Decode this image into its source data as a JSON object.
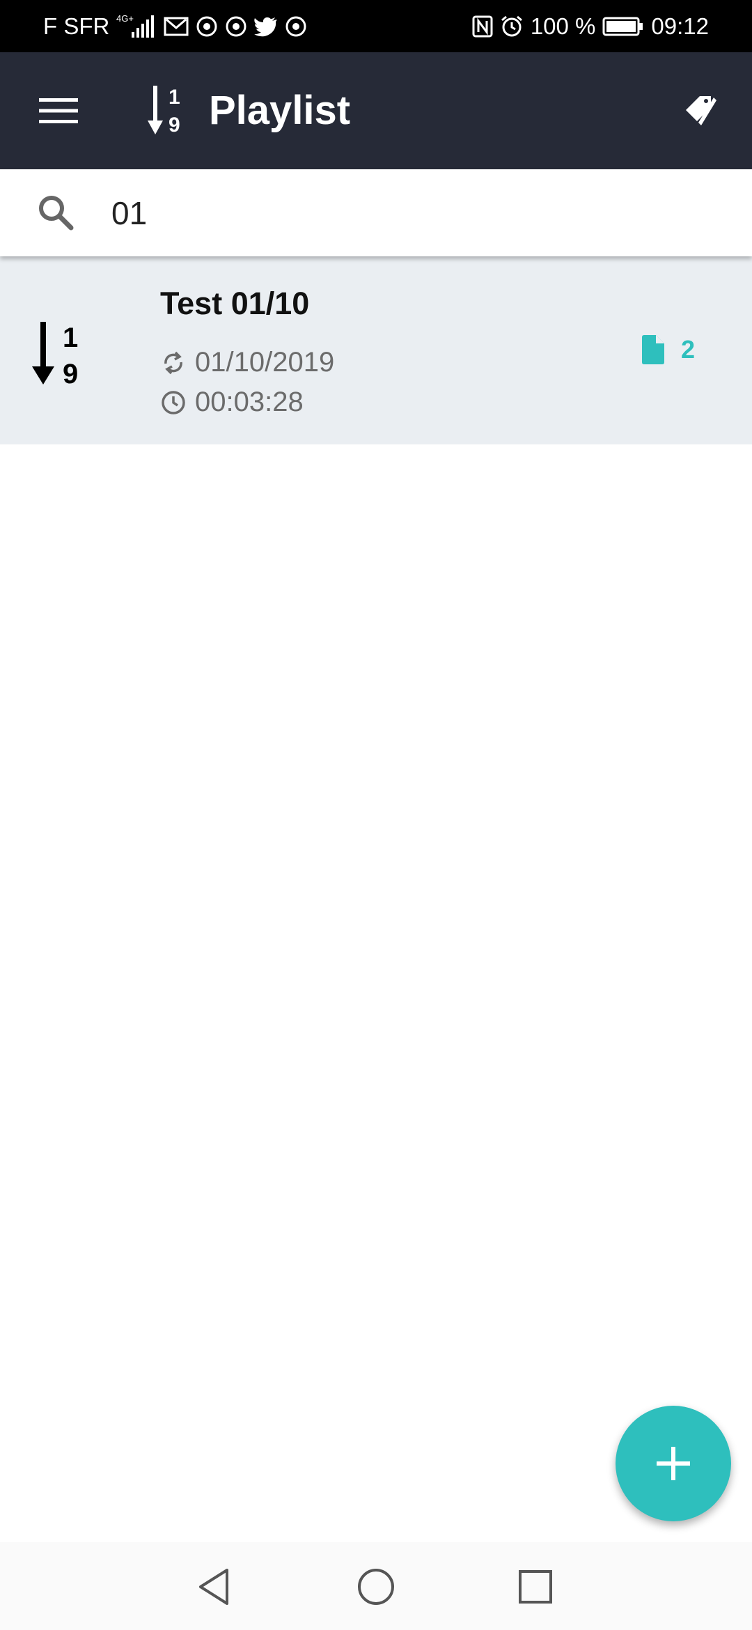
{
  "status_bar": {
    "carrier": "F SFR",
    "network": "4G+",
    "battery": "100 %",
    "time": "09:12",
    "left_icons": [
      "signal-icon",
      "gmail-icon",
      "chrome-icon",
      "chrome-icon",
      "twitter-icon",
      "chrome-icon"
    ],
    "right_icons": [
      "nfc-icon",
      "alarm-icon",
      "battery-icon"
    ]
  },
  "app_bar": {
    "title": "Playlist",
    "title_icon": "sort-numeric-icon",
    "menu_icon": "hamburger-menu-icon",
    "action_icon": "tags-icon"
  },
  "search": {
    "value": "01",
    "icon": "search-icon"
  },
  "playlists": [
    {
      "title": "Test 01/10",
      "date": "01/10/2019",
      "duration": "00:03:28",
      "file_count": "2",
      "icon": "sort-numeric-icon"
    }
  ],
  "fab": {
    "icon": "plus-icon"
  },
  "nav": {
    "icons": [
      "back-icon",
      "home-icon",
      "recents-icon"
    ]
  },
  "colors": {
    "appbar": "#262a37",
    "accent": "#2ebfbd",
    "list_item_bg": "#eaeef2",
    "status_bar": "#000000"
  }
}
